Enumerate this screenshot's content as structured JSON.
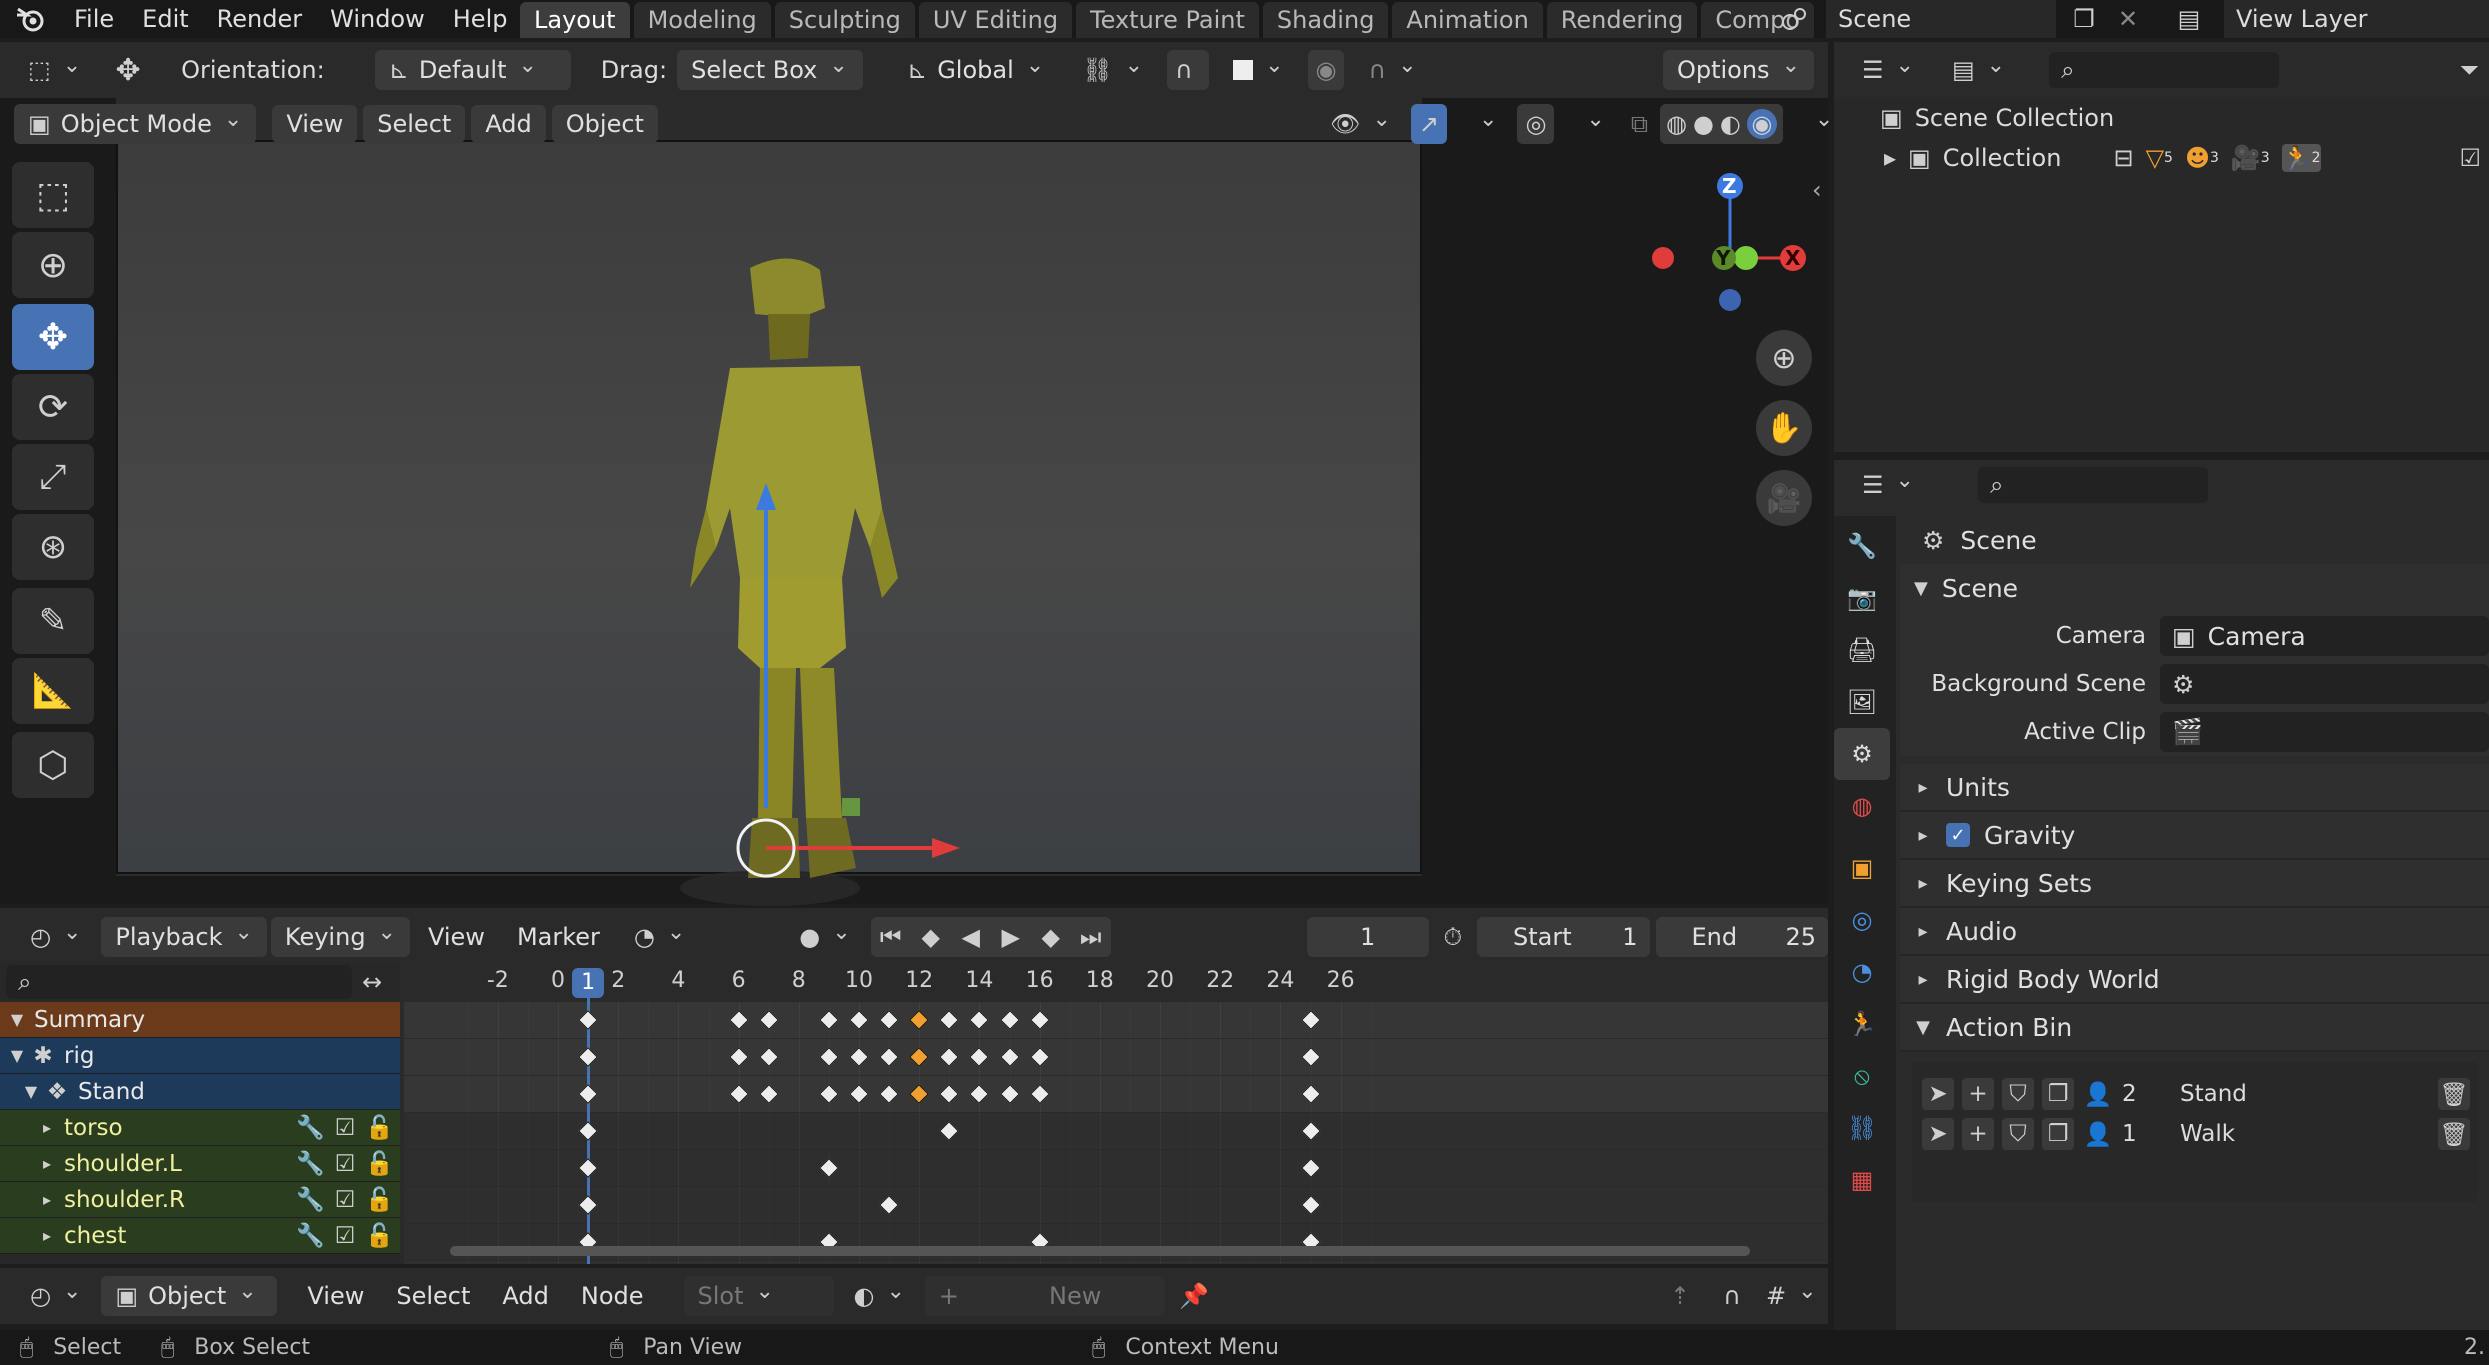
{
  "menu": [
    "File",
    "Edit",
    "Render",
    "Window",
    "Help"
  ],
  "workspaces": [
    {
      "label": "Layout",
      "active": true
    },
    {
      "label": "Modeling"
    },
    {
      "label": "Sculpting"
    },
    {
      "label": "UV Editing"
    },
    {
      "label": "Texture Paint"
    },
    {
      "label": "Shading"
    },
    {
      "label": "Animation"
    },
    {
      "label": "Rendering"
    },
    {
      "label": "Compo"
    }
  ],
  "scene_selector": "Scene",
  "view_layer": "View Layer",
  "tool_header": {
    "orientation_label": "Orientation:",
    "orientation_value": "Default",
    "drag_label": "Drag:",
    "drag_value": "Select Box",
    "transform_orientation": "Global",
    "options": "Options"
  },
  "viewport_header": {
    "mode": "Object Mode",
    "menus": [
      "View",
      "Select",
      "Add",
      "Object"
    ]
  },
  "gizmo": {
    "z": "Z",
    "y": "Y",
    "x": "X"
  },
  "outliner": {
    "scene_collection": "Scene Collection",
    "collection": "Collection",
    "counts": {
      "mesh": "5",
      "armature": "3",
      "camera": "3",
      "action": "2"
    }
  },
  "timeline_header": {
    "menus": [
      "Playback",
      "Keying",
      "View",
      "Marker"
    ],
    "current_frame": "1",
    "start_label": "Start",
    "start_value": "1",
    "end_label": "End",
    "end_value": "25"
  },
  "ruler": [
    "-2",
    "0",
    "1",
    "2",
    "4",
    "6",
    "8",
    "10",
    "12",
    "14",
    "16",
    "18",
    "20",
    "22",
    "24",
    "26"
  ],
  "channels": [
    {
      "label": "Summary",
      "kind": "summary"
    },
    {
      "label": "rig",
      "kind": "object"
    },
    {
      "label": "Stand",
      "kind": "action"
    },
    {
      "label": "torso",
      "kind": "group"
    },
    {
      "label": "shoulder.L",
      "kind": "group"
    },
    {
      "label": "shoulder.R",
      "kind": "group"
    },
    {
      "label": "chest",
      "kind": "group"
    }
  ],
  "keyframes": {
    "summary": [
      1,
      6,
      7,
      9,
      10,
      11,
      12,
      13,
      14,
      15,
      16,
      25
    ],
    "rig": [
      1,
      6,
      7,
      9,
      10,
      11,
      12,
      13,
      14,
      15,
      16,
      25
    ],
    "stand": [
      1,
      6,
      7,
      9,
      10,
      11,
      12,
      13,
      14,
      15,
      16,
      25
    ],
    "torso": [
      1,
      13,
      25
    ],
    "shoulder_l": [
      1,
      9,
      25
    ],
    "shoulder_r": [
      1,
      11,
      25
    ],
    "chest": [
      1,
      9,
      16,
      25
    ],
    "selected_frame": 12
  },
  "node_header": {
    "mode": "Object",
    "menus": [
      "View",
      "Select",
      "Add",
      "Node"
    ],
    "slot": "Slot",
    "new": "New"
  },
  "properties": {
    "title": "Scene",
    "section_scene": "Scene",
    "camera_label": "Camera",
    "camera_value": "Camera",
    "background_label": "Background Scene",
    "clip_label": "Active Clip",
    "sections": [
      "Units",
      "Gravity",
      "Keying Sets",
      "Audio",
      "Rigid Body World",
      "Action Bin"
    ],
    "actions": [
      {
        "users": "2",
        "name": "Stand"
      },
      {
        "users": "1",
        "name": "Walk"
      }
    ]
  },
  "status_bar": {
    "select": "Select",
    "box_select": "Box Select",
    "pan_view": "Pan View",
    "context_menu": "Context Menu",
    "version": "2."
  }
}
